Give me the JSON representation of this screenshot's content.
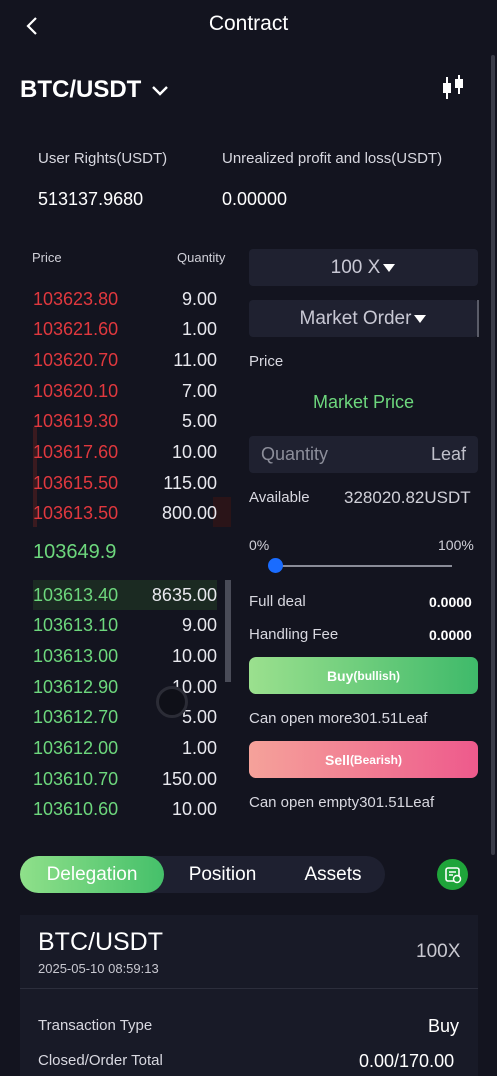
{
  "header": {
    "title": "Contract"
  },
  "pair": {
    "symbol": "BTC/USDT"
  },
  "account": {
    "rights_label": "User Rights(USDT)",
    "rights_value": "513137.9680",
    "pnl_label": "Unrealized profit and loss(USDT)",
    "pnl_value": "0.00000"
  },
  "orderbook": {
    "price_header": "Price",
    "qty_header": "Quantity",
    "asks": [
      {
        "price": "103623.80",
        "qty": "9.00"
      },
      {
        "price": "103621.60",
        "qty": "1.00"
      },
      {
        "price": "103620.70",
        "qty": "11.00"
      },
      {
        "price": "103620.10",
        "qty": "7.00"
      },
      {
        "price": "103619.30",
        "qty": "5.00"
      },
      {
        "price": "103617.60",
        "qty": "10.00"
      },
      {
        "price": "103615.50",
        "qty": "115.00"
      },
      {
        "price": "103613.50",
        "qty": "800.00"
      }
    ],
    "mid_price": "103649.9",
    "bids": [
      {
        "price": "103613.40",
        "qty": "8635.00"
      },
      {
        "price": "103613.10",
        "qty": "9.00"
      },
      {
        "price": "103613.00",
        "qty": "10.00"
      },
      {
        "price": "103612.90",
        "qty": "10.00"
      },
      {
        "price": "103612.70",
        "qty": "5.00"
      },
      {
        "price": "103612.00",
        "qty": "1.00"
      },
      {
        "price": "103610.70",
        "qty": "150.00"
      },
      {
        "price": "103610.60",
        "qty": "10.00"
      }
    ]
  },
  "trade": {
    "leverage": "100 X",
    "order_type": "Market Order",
    "price_label": "Price",
    "price_value": "Market Price",
    "quantity_placeholder": "Quantity",
    "unit": "Leaf",
    "available_label": "Available",
    "available_value": "328020.82USDT",
    "slider_min": "0%",
    "slider_max": "100%",
    "slider_level_percent": 0,
    "full_deal_label": "Full deal",
    "full_deal_value": "0.0000",
    "fee_label": "Handling Fee",
    "fee_value": "0.0000",
    "buy_label": "Buy",
    "buy_sub": "(bullish)",
    "can_open_more": "Can open more301.51Leaf",
    "sell_label": "Sell",
    "sell_sub": "(Bearish)",
    "can_open_empty": "Can open empty301.51Leaf"
  },
  "tabs": [
    "Delegation",
    "Position",
    "Assets"
  ],
  "order_card": {
    "symbol": "BTC/USDT",
    "datetime": "2025-05-10 08:59:13",
    "leverage": "100X",
    "type_label": "Transaction Type",
    "type_value": "Buy",
    "total_label": "Closed/Order Total",
    "total_value": "0.00/170.00"
  },
  "colors": {
    "background": "#13141f",
    "ask_red": "#e0383e",
    "bid_green": "#6dd77d",
    "accent_blue": "#1a6cff"
  },
  "icons": [
    "back-arrow-icon",
    "chevron-down-icon",
    "candlestick-icon",
    "caret-down-icon",
    "order-history-icon"
  ]
}
